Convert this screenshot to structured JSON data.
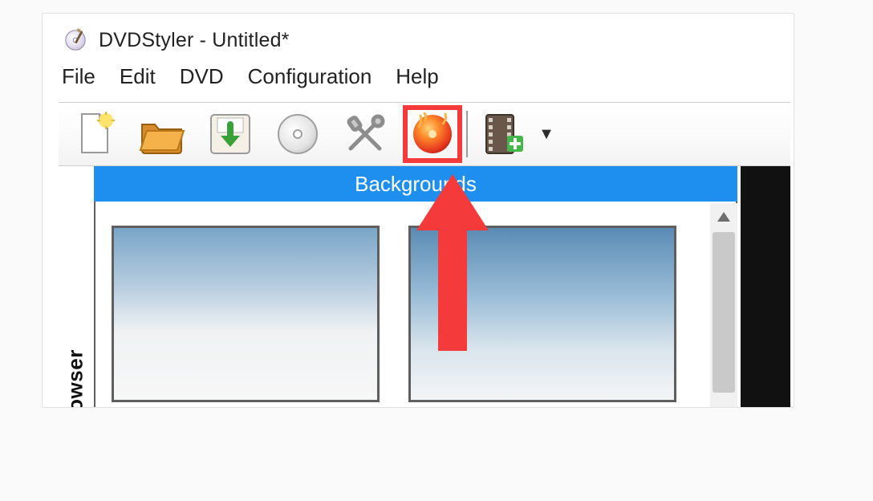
{
  "window": {
    "title": "DVDStyler - Untitled*"
  },
  "menubar": {
    "items": [
      "File",
      "Edit",
      "DVD",
      "Configuration",
      "Help"
    ]
  },
  "toolbar": {
    "buttons": [
      {
        "name": "new-file-icon"
      },
      {
        "name": "open-folder-icon"
      },
      {
        "name": "save-icon"
      },
      {
        "name": "disc-settings-icon"
      },
      {
        "name": "options-icon"
      },
      {
        "name": "burn-disc-icon"
      }
    ],
    "extra_buttons": [
      {
        "name": "add-video-icon"
      }
    ],
    "dropdown_caret": "▼",
    "highlight_index": 5
  },
  "sidebar": {
    "tab_label": "browser",
    "panel_header": "Backgrounds"
  },
  "colors": {
    "accent_blue": "#1f8fef",
    "highlight_red": "#f43a3a"
  }
}
